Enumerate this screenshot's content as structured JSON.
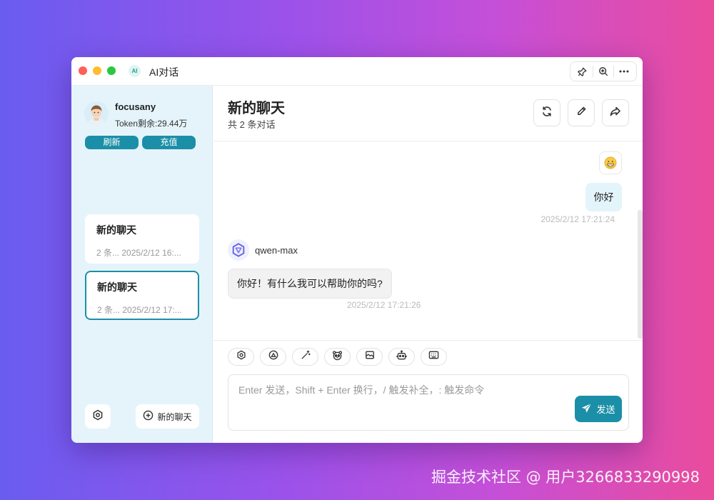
{
  "window": {
    "title": "AI对话",
    "logo_text": "AI"
  },
  "sidebar": {
    "user": {
      "name": "focusany",
      "token_label": "Token剩余:29.44万"
    },
    "refresh_label": "刷新",
    "recharge_label": "充值",
    "chats": [
      {
        "title": "新的聊天",
        "meta": "2 条...  2025/2/12 16:..."
      },
      {
        "title": "新的聊天",
        "meta": "2 条...  2025/2/12 17:..."
      }
    ],
    "new_chat_label": "新的聊天"
  },
  "main": {
    "title": "新的聊天",
    "subtitle": "共 2 条对话",
    "messages": {
      "user_text": "你好",
      "user_time": "2025/2/12 17:21:24",
      "bot_name": "qwen-max",
      "bot_text": "你好！有什么我可以帮助你的吗?",
      "bot_time": "2025/2/12 17:21:26"
    },
    "composer": {
      "placeholder": "Enter 发送，Shift + Enter 换行，/ 触发补全，: 触发命令",
      "send_label": "发送",
      "tools": [
        "settings-icon",
        "model-icon",
        "magic-wand-icon",
        "panda-icon",
        "image-icon",
        "robot-icon",
        "keyboard-icon"
      ]
    }
  },
  "watermark": "掘金技术社区 @ 用户3266833290998",
  "colors": {
    "accent": "#1b8fa7",
    "sidebar_bg": "#e5f4fb",
    "user_bubble": "#e3f4fb"
  }
}
